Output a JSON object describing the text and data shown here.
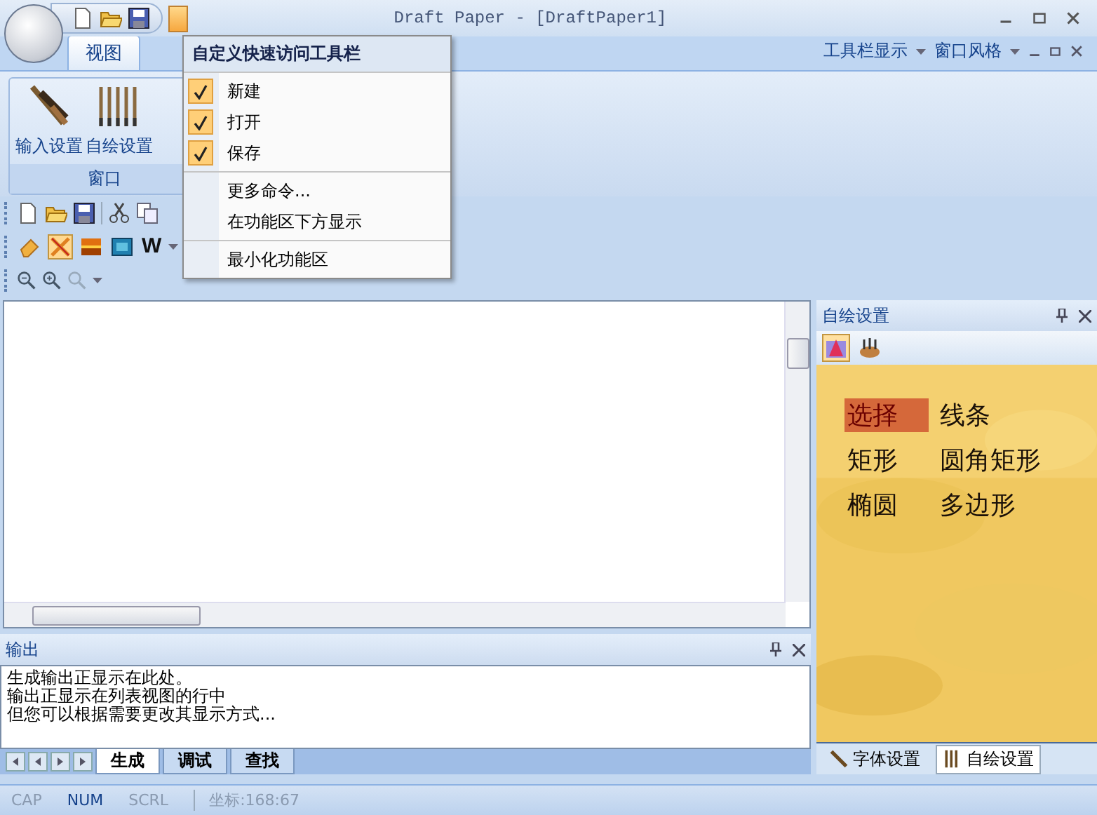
{
  "window": {
    "title": "Draft Paper - [DraftPaper1]"
  },
  "ribbon": {
    "tabs": [
      {
        "label": "视图",
        "selected": true
      }
    ],
    "right_menus": [
      "工具栏显示",
      "窗口风格"
    ],
    "groups": [
      {
        "label": "窗口",
        "buttons": [
          {
            "label": "输入设置",
            "kind": "brushes"
          },
          {
            "label": "自绘设置",
            "kind": "pens"
          }
        ]
      }
    ]
  },
  "qat_menu": {
    "title": "自定义快速访问工具栏",
    "sections": [
      [
        {
          "label": "新建",
          "kind": "check",
          "checked": true
        },
        {
          "label": "打开",
          "kind": "check",
          "checked": true
        },
        {
          "label": "保存",
          "kind": "check",
          "checked": true
        }
      ],
      [
        {
          "label": "更多命令...",
          "kind": "command"
        },
        {
          "label": "在功能区下方显示",
          "kind": "command"
        }
      ],
      [
        {
          "label": "最小化功能区",
          "kind": "command"
        }
      ]
    ]
  },
  "toolbar_tools": [
    {
      "kind": "eraser",
      "selected": false
    },
    {
      "kind": "pencil",
      "selected": true
    },
    {
      "kind": "sunset",
      "selected": false
    },
    {
      "kind": "film",
      "selected": false
    },
    {
      "kind": "text",
      "label": "W",
      "selected": false
    }
  ],
  "draw_panel": {
    "title": "自绘设置",
    "modes": [
      {
        "kind": "shape",
        "selected": true
      },
      {
        "kind": "palette",
        "selected": false
      }
    ],
    "tools": [
      {
        "label": "选择",
        "selected": true
      },
      {
        "label": "线条",
        "selected": false
      },
      {
        "label": "矩形",
        "selected": false
      },
      {
        "label": "圆角矩形",
        "selected": false
      },
      {
        "label": "椭圆",
        "selected": false
      },
      {
        "label": "多边形",
        "selected": false
      }
    ]
  },
  "dock_tabs": [
    {
      "label": "字体设置",
      "selected": false
    },
    {
      "label": "自绘设置",
      "selected": true
    }
  ],
  "output": {
    "title": "输出",
    "lines": [
      "生成输出正显示在此处。",
      "输出正显示在列表视图的行中",
      "但您可以根据需要更改其显示方式..."
    ],
    "tabs": [
      {
        "label": "生成",
        "selected": true
      },
      {
        "label": "调试",
        "selected": false
      },
      {
        "label": "查找",
        "selected": false
      }
    ]
  },
  "status_bar": {
    "indicators": [
      {
        "label": "CAP",
        "on": false
      },
      {
        "label": "NUM",
        "on": true
      },
      {
        "label": "SCRL",
        "on": false
      }
    ],
    "position": "坐标:168:67"
  }
}
